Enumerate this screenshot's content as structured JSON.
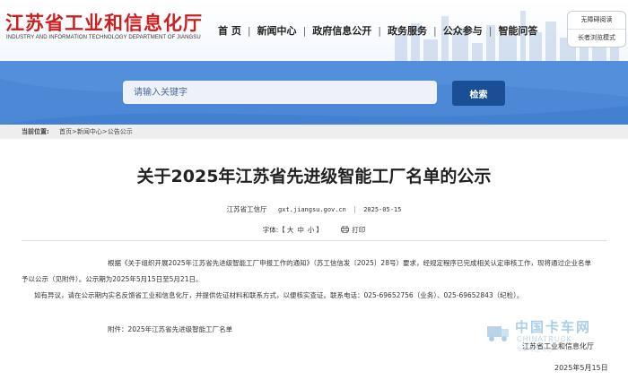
{
  "header": {
    "logo_title": "江苏省工业和信息化厅",
    "logo_subtitle": "INDUSTRY AND INFORMATION TECHNOLOGY DEPARTMENT OF JIANGSU",
    "nav": [
      "首 页",
      "新闻中心",
      "政府信息公开",
      "政务服务",
      "公众参与",
      "智能问答"
    ],
    "accessibility": [
      "无障碍阅读",
      "长者浏览模式"
    ]
  },
  "search": {
    "placeholder": "请输入关键字",
    "button_label": "检索"
  },
  "breadcrumb": {
    "label": "当前位置:",
    "path": "首页>新闻中心>公告公示"
  },
  "article": {
    "title": "关于2025年江苏省先进级智能工厂名单的公示",
    "source": "江苏省工信厅",
    "site": "gxt.jiangsu.gov.cn",
    "divider": "|",
    "date": "2025-05-15",
    "font_label": "字体:【",
    "font_sizes": [
      "大",
      "中",
      "小"
    ],
    "font_close": "】",
    "print_label": "打印",
    "paragraphs": [
      "根据《关于组织开展2025年江苏省先进级智能工厂申报工作的通知》（苏工信信发〔2025〕28号）要求，经规定程序已完成相关认定审核工作，现将通过企业名单予以公示（见附件）。公示期为2025年5月15日至5月21日。",
      "如有异议，请在公示期内实名反馈省工业和信息化厅，并提供佐证材料和联系方式，以便核实查证。联系电话：025-69652756（业务）、025-69652843（纪检）。",
      "附件：2025年江苏省先进级智能工厂名单"
    ],
    "signature_org": "江苏省工业和信息化厅",
    "signature_date": "2025年5月15日"
  },
  "watermark": {
    "cn": "中国卡车网",
    "en": "CHINATRUCK",
    "tag": "专业·专注·专心"
  }
}
